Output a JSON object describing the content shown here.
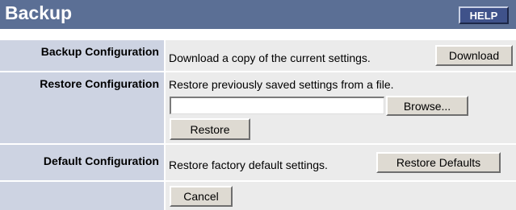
{
  "header": {
    "title": "Backup",
    "help_label": "HELP"
  },
  "backup": {
    "label": "Backup Configuration",
    "description": "Download a copy of the current settings.",
    "button": "Download"
  },
  "restore": {
    "label": "Restore Configuration",
    "description": "Restore previously saved settings from a file.",
    "file_value": "",
    "browse_button": "Browse...",
    "restore_button": "Restore"
  },
  "defaults": {
    "label": "Default Configuration",
    "description": "Restore factory default settings.",
    "button": "Restore Defaults"
  },
  "footer": {
    "cancel_button": "Cancel"
  },
  "colors": {
    "header_bg": "#5b6f95",
    "label_bg": "#cdd3e2",
    "content_bg": "#ebebeb",
    "help_bg": "#3f528a"
  }
}
